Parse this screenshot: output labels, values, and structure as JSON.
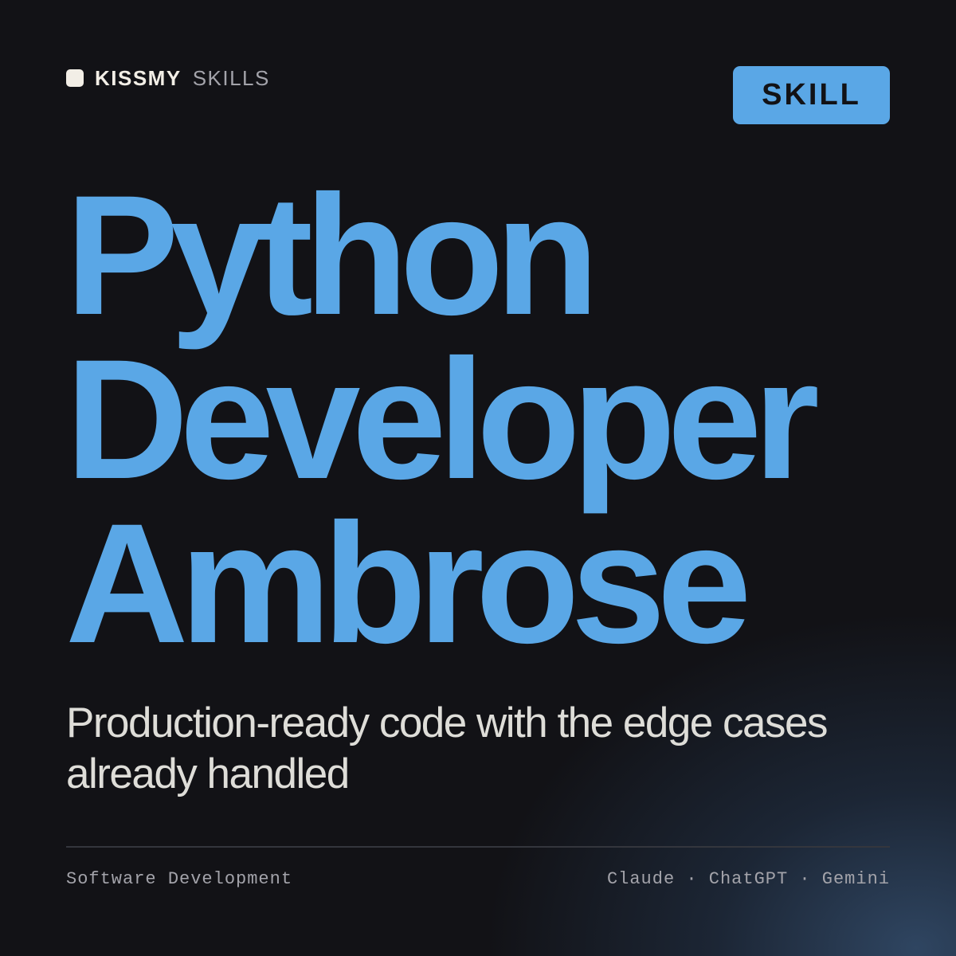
{
  "brand": {
    "name_strong": "KISSMY",
    "name_light": "SKILLS"
  },
  "badge": {
    "label": "SKILL"
  },
  "title": {
    "lines": [
      "Python",
      "Developer",
      "Ambrose"
    ]
  },
  "subtitle": "Production-ready code with the edge cases already handled",
  "footer": {
    "category": "Software Development",
    "platforms": "Claude · ChatGPT · Gemini"
  },
  "colors": {
    "accent": "#5aa7e6",
    "background": "#121216",
    "text_light": "#deddd8",
    "text_muted": "#a3a3aa"
  }
}
